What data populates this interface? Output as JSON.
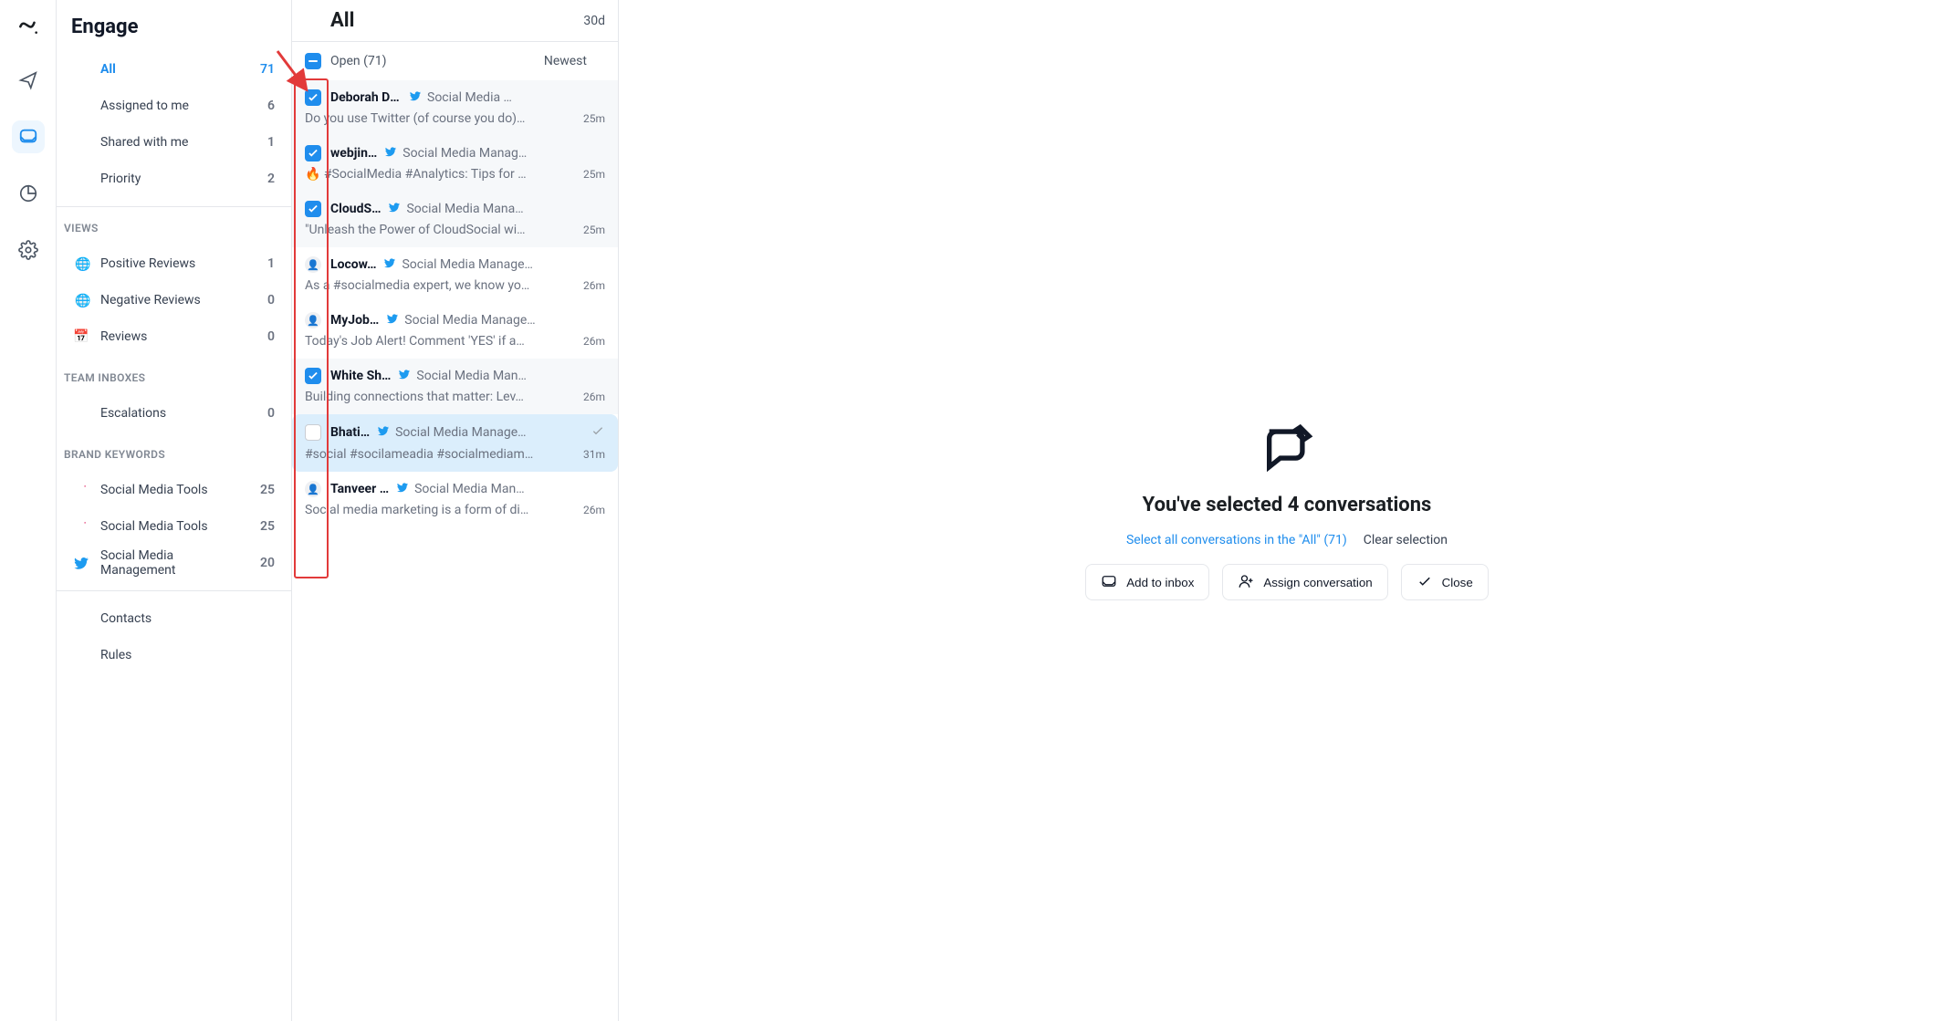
{
  "sidebar": {
    "title": "Engage",
    "nav": {
      "all_label": "All",
      "all_count": "71",
      "assigned_label": "Assigned to me",
      "assigned_count": "6",
      "shared_label": "Shared with me",
      "shared_count": "1",
      "priority_label": "Priority",
      "priority_count": "2"
    },
    "views_title": "VIEWS",
    "views": {
      "positive_label": "Positive Reviews",
      "positive_count": "1",
      "negative_label": "Negative Reviews",
      "negative_count": "0",
      "reviews_label": "Reviews",
      "reviews_count": "0"
    },
    "team_title": "TEAM INBOXES",
    "team": {
      "escalations_label": "Escalations",
      "escalations_count": "0"
    },
    "brand_title": "BRAND KEYWORDS",
    "brand": {
      "tools1_label": "Social Media Tools",
      "tools1_count": "25",
      "tools2_label": "Social Media Tools",
      "tools2_count": "25",
      "mgmt_label": "Social Media Management",
      "mgmt_count": "20"
    },
    "extra": {
      "contacts_label": "Contacts",
      "rules_label": "Rules"
    }
  },
  "list": {
    "title": "All",
    "range_label": "30d",
    "open_label": "Open (71)",
    "sort_label": "Newest"
  },
  "items": [
    {
      "name": "Deborah Dia…",
      "src": "Social Media …",
      "preview": "Do you use Twitter (of course you do)…",
      "time": "25m",
      "checked": true,
      "avatar": false
    },
    {
      "name": "webjin…",
      "src": "Social Media Manag…",
      "preview": "🔥 #SocialMedia #Analytics: Tips for …",
      "time": "25m",
      "checked": true,
      "avatar": false
    },
    {
      "name": "CloudS…",
      "src": "Social Media Mana…",
      "preview": "\"Unleash the Power of CloudSocial wi…",
      "time": "25m",
      "checked": true,
      "avatar": false
    },
    {
      "name": "Locow…",
      "src": "Social Media Manage…",
      "preview": "As a #socialmedia expert, we know yo…",
      "time": "26m",
      "checked": false,
      "avatar": true
    },
    {
      "name": "MyJob…",
      "src": "Social Media Manage…",
      "preview": "Today's Job Alert! Comment 'YES' if a…",
      "time": "26m",
      "checked": false,
      "avatar": true
    },
    {
      "name": "White Sh…",
      "src": "Social Media Man…",
      "preview": "Building connections that matter: Lev…",
      "time": "26m",
      "checked": true,
      "avatar": false
    },
    {
      "name": "Bhati…",
      "src": "Social Media Manage…",
      "preview": "#social #socilameadia #socialmediam…",
      "time": "31m",
      "checked": false,
      "avatar": false,
      "focused": true,
      "done": true
    },
    {
      "name": "Tanveer …",
      "src": "Social Media Man…",
      "preview": "Social media marketing is a form of di…",
      "time": "26m",
      "checked": false,
      "avatar": true
    }
  ],
  "selection": {
    "count_text": "You've selected 4 conversations",
    "select_all": "Select all conversations in the \"All\" (71)",
    "clear": "Clear selection",
    "buttons": {
      "add_inbox": "Add to inbox",
      "assign": "Assign conversation",
      "close": "Close"
    }
  }
}
